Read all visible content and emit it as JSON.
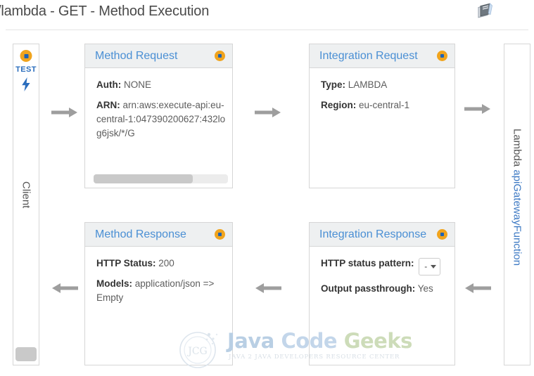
{
  "header": {
    "title": "/lambda - GET - Method Execution",
    "doc_icon": "documentation-book-icon"
  },
  "client_column": {
    "test_label": "TEST",
    "label": "Client",
    "dot_icon": "orange-status-dot-icon",
    "bolt_icon": "lightning-bolt-icon",
    "scrollbar": "vertical-scroll-thumb"
  },
  "lambda_column": {
    "label_prefix": "Lambda ",
    "function_name": "apiGatewayFunction"
  },
  "nodes": {
    "method_request": {
      "title": "Method Request",
      "dot_icon": "orange-status-dot-icon",
      "fields": [
        {
          "key": "Auth:",
          "value": "NONE"
        },
        {
          "key": "ARN:",
          "value": "arn:aws:execute-api:eu-central-1:047390200627:432log6jsk/*/G"
        }
      ],
      "has_scrollbar": true
    },
    "integration_request": {
      "title": "Integration Request",
      "dot_icon": "orange-status-dot-icon",
      "fields": [
        {
          "key": "Type:",
          "value": "LAMBDA"
        },
        {
          "key": "Region:",
          "value": "eu-central-1"
        }
      ],
      "has_scrollbar": false
    },
    "method_response": {
      "title": "Method Response",
      "dot_icon": "orange-status-dot-icon",
      "fields": [
        {
          "key": "HTTP Status:",
          "value": "200"
        },
        {
          "key": "Models:",
          "value": "application/json => Empty"
        }
      ],
      "has_scrollbar": false
    },
    "integration_response": {
      "title": "Integration Response",
      "dot_icon": "orange-status-dot-icon",
      "fields": [
        {
          "key": "HTTP status pattern:",
          "value": "-"
        },
        {
          "key": "Output passthrough:",
          "value": "Yes"
        }
      ],
      "status_pattern_selected": "-",
      "has_scrollbar": false
    }
  },
  "arrows": {
    "client_to_method_request": "right",
    "method_request_to_integration_request": "right",
    "integration_request_to_lambda": "right",
    "lambda_to_integration_response": "left",
    "integration_response_to_method_response": "left",
    "method_response_to_client": "left"
  },
  "watermark": {
    "word1": "Java",
    "word2": "Code",
    "word3": "Geeks",
    "tagline": "JAVA 2 JAVA DEVELOPERS RESOURCE CENTER",
    "logo": "JCG"
  },
  "colors": {
    "accent_blue": "#4a8fd4",
    "status_orange": "#f0a41e",
    "link_blue": "#3b78c3",
    "panel_header": "#eef0f1",
    "border": "#d6d6d6",
    "arrow_gray": "#9e9e9e"
  }
}
